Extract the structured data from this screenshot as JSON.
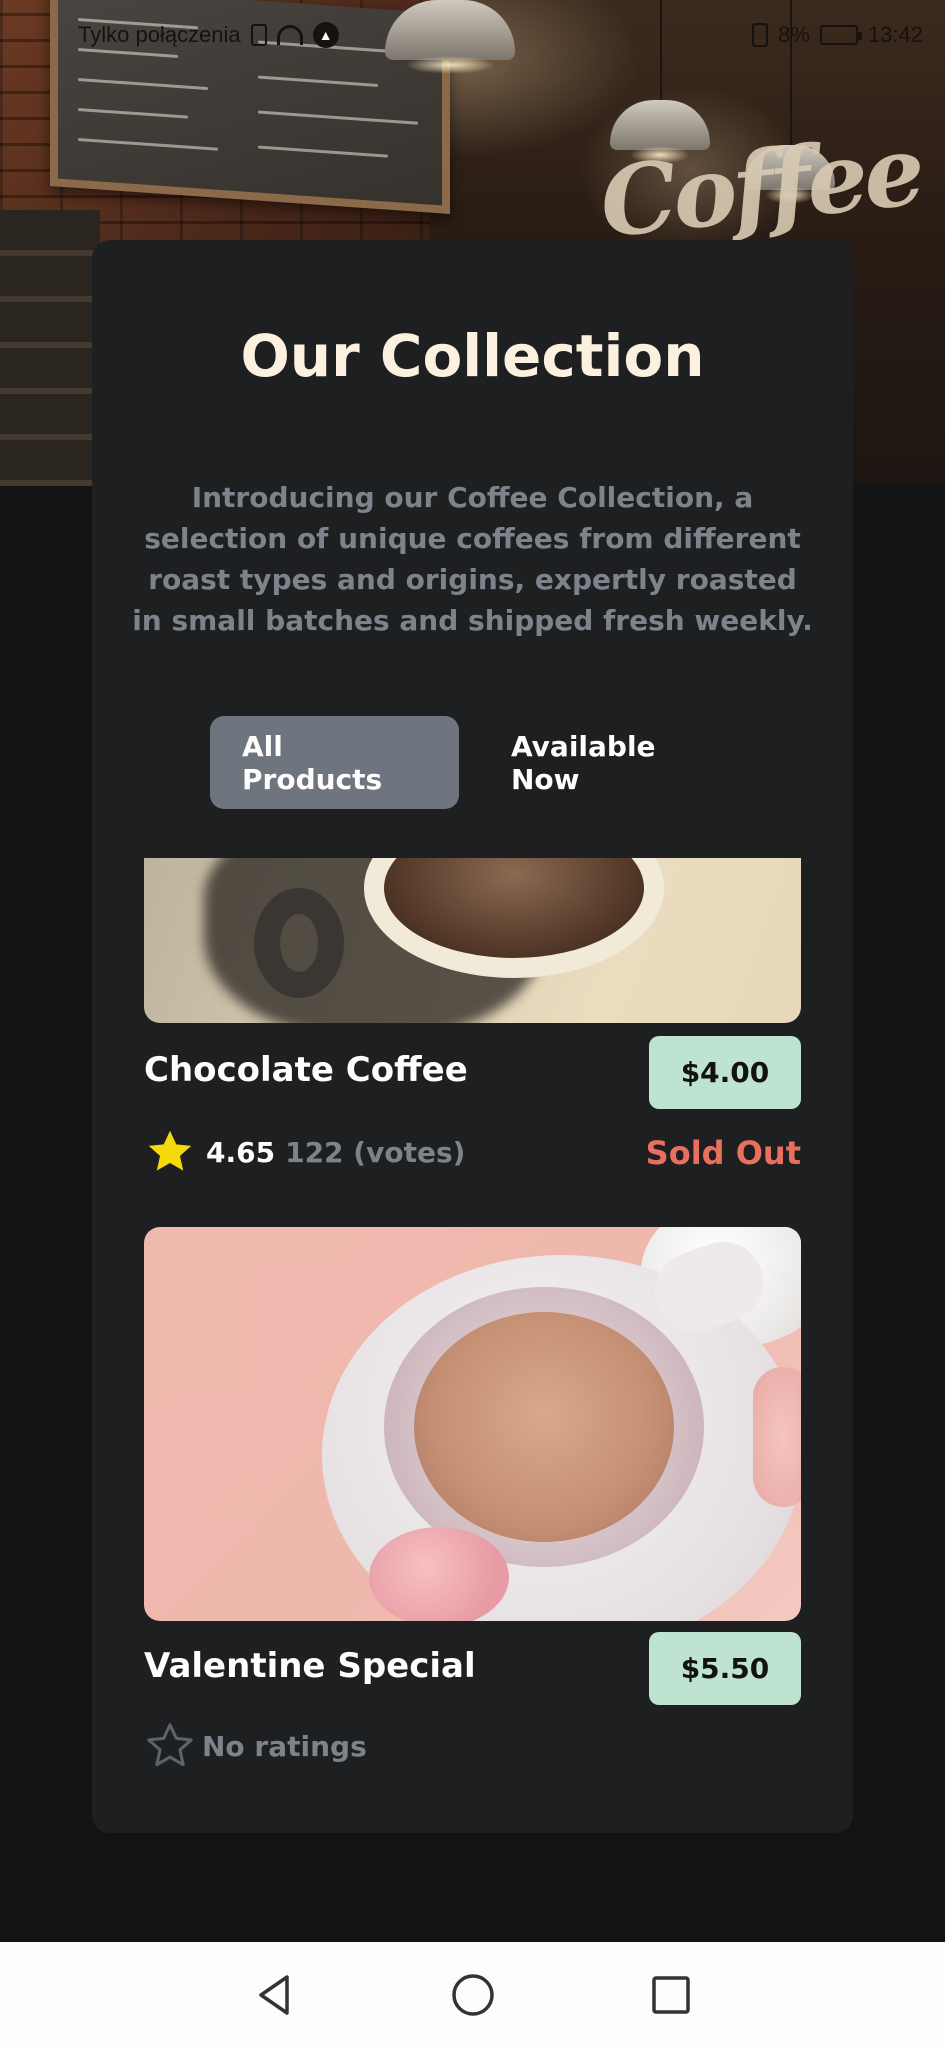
{
  "status_bar": {
    "carrier_text": "Tylko połączenia",
    "battery_percent": "8%",
    "time": "13:42",
    "icons": [
      "sim-icon",
      "wifi-icon",
      "app-notification-icon",
      "vibrate-icon",
      "battery-icon"
    ]
  },
  "collection": {
    "title": "Our Collection",
    "intro": "Introducing our Coffee Collection, a selection of unique coffees from different roast types and origins, expertly roasted in small batches and shipped fresh weekly.",
    "tabs": [
      {
        "label": "All Products",
        "active": true
      },
      {
        "label": "Available Now",
        "active": false
      }
    ]
  },
  "products": [
    {
      "name": "Chocolate Coffee",
      "price": "$4.00",
      "rating": "4.65",
      "votes": "122 (votes)",
      "status": "Sold Out",
      "star_icon": "filled-star-icon"
    },
    {
      "name": "Valentine Special",
      "price": "$5.50",
      "rating_text": "No ratings",
      "star_icon": "empty-star-icon"
    }
  ],
  "nav": {
    "icons": [
      "back-triangle-icon",
      "home-circle-icon",
      "recents-square-icon"
    ]
  },
  "colors": {
    "card_bg": "#1e1f21",
    "title": "#fbf1de",
    "muted_text": "#7e828a",
    "active_tab": "#6f757e",
    "price_badge": "#bee3d0",
    "sold_out": "#e9705f",
    "star": "#f5d90a"
  }
}
